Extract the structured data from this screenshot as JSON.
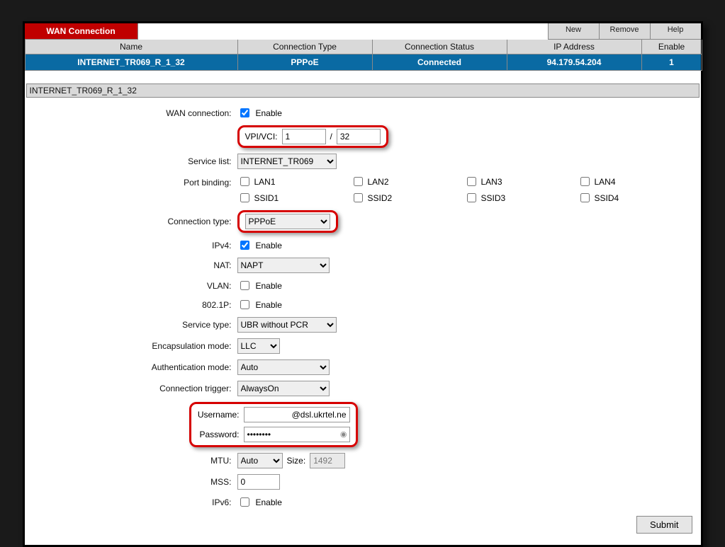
{
  "tabs": {
    "wan": "WAN Connection"
  },
  "topButtons": {
    "new": "New",
    "remove": "Remove",
    "help": "Help"
  },
  "headers": {
    "name": "Name",
    "type": "Connection Type",
    "status": "Connection Status",
    "ip": "IP Address",
    "enable": "Enable"
  },
  "selectedConn": {
    "name": "INTERNET_TR069_R_1_32",
    "type": "PPPoE",
    "status": "Connected",
    "ip": "94.179.54.204",
    "enable": "1"
  },
  "section": "INTERNET_TR069_R_1_32",
  "labels": {
    "wanConn": "WAN connection:",
    "vpivci": "VPI/VCI:",
    "serviceList": "Service list:",
    "portBinding": "Port binding:",
    "connType": "Connection type:",
    "ipv4": "IPv4:",
    "nat": "NAT:",
    "vlan": "VLAN:",
    "dot1p": "802.1P:",
    "serviceType": "Service type:",
    "encap": "Encapsulation mode:",
    "auth": "Authentication mode:",
    "trigger": "Connection trigger:",
    "username": "Username:",
    "password": "Password:",
    "mtu": "MTU:",
    "size": "Size:",
    "mss": "MSS:",
    "ipv6": "IPv6:"
  },
  "values": {
    "enableText": "Enable",
    "vpi": "1",
    "vciSep": "/",
    "vci": "32",
    "serviceList": "INTERNET_TR069",
    "connType": "PPPoE",
    "nat": "NAPT",
    "serviceType": "UBR without PCR",
    "encap": "LLC",
    "auth": "Auto",
    "trigger": "AlwaysOn",
    "usernameSuffix": "@dsl.ukrtel.ne",
    "password": "••••••••",
    "mtu": "Auto",
    "size": "1492",
    "mss": "0"
  },
  "ports": {
    "lan1": "LAN1",
    "lan2": "LAN2",
    "lan3": "LAN3",
    "lan4": "LAN4",
    "ssid1": "SSID1",
    "ssid2": "SSID2",
    "ssid3": "SSID3",
    "ssid4": "SSID4"
  },
  "submit": "Submit"
}
